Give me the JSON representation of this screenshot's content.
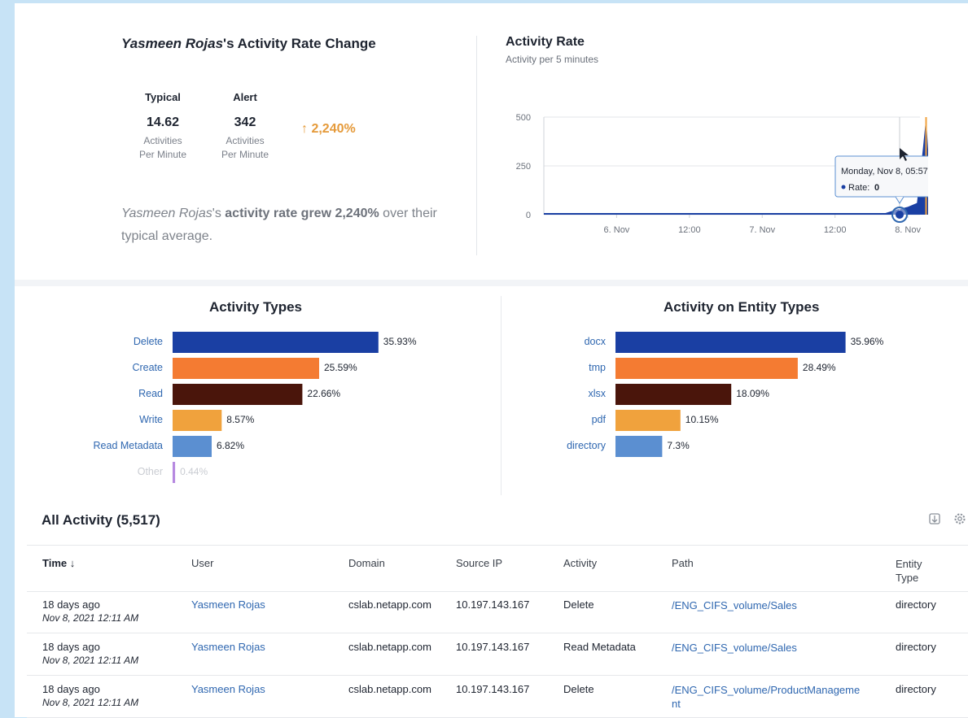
{
  "rate_change": {
    "user": "Yasmeen Rojas",
    "title_suffix": "'s Activity Rate Change",
    "typical_label": "Typical",
    "typical_value": "14.62",
    "typical_unit_1": "Activities",
    "typical_unit_2": "Per Minute",
    "alert_label": "Alert",
    "alert_value": "342",
    "alert_unit_1": "Activities",
    "alert_unit_2": "Per Minute",
    "change": "↑ 2,240%",
    "summary_suffix": "'s",
    "summary_bold": "activity rate grew 2,240%",
    "summary_rest": " over their typical average."
  },
  "activity_rate": {
    "title": "Activity Rate",
    "subtitle": "Activity per 5 minutes",
    "tooltip_date": "Monday, Nov 8, 05:57",
    "tooltip_label": "Rate:",
    "tooltip_value": "0"
  },
  "colors": {
    "navy": "#1a3fa3",
    "orange": "#f47b32",
    "brown": "#4a150b",
    "light_orange": "#f0a23d",
    "steel_blue": "#5b8fd1",
    "purple": "#a46ad8",
    "alert_orange": "#e59a3a",
    "link_blue": "#2f67b0"
  },
  "chart_data": [
    {
      "type": "line",
      "title": "Activity Rate",
      "subtitle": "Activity per 5 minutes",
      "x_tick_labels": [
        "6. Nov",
        "12:00",
        "7. Nov",
        "12:00",
        "8. Nov",
        "12:00"
      ],
      "y_tick_labels": [
        "0",
        "250",
        "500"
      ],
      "ylim": [
        0,
        550
      ],
      "series": [
        {
          "points": [
            [
              "Nov 5 12:00",
              2
            ],
            [
              "Nov 6 00:00",
              3
            ],
            [
              "Nov 6 12:00",
              2
            ],
            [
              "Nov 7 00:00",
              3
            ],
            [
              "Nov 7 12:00",
              2
            ],
            [
              "Nov 7 20:00",
              5
            ],
            [
              "Nov 7 22:00",
              25
            ],
            [
              "Nov 8 00:00",
              40
            ],
            [
              "Nov 8 01:30",
              60
            ],
            [
              "Nov 8 02:30",
              342
            ],
            [
              "Nov 8 03:00",
              500
            ],
            [
              "Nov 8 04:00",
              10
            ],
            [
              "Nov 8 05:57",
              0
            ],
            [
              "Nov 8 14:00",
              0
            ]
          ]
        }
      ]
    },
    {
      "type": "bar",
      "title": "Activity Types",
      "categories": [
        "Delete",
        "Create",
        "Read",
        "Write",
        "Read Metadata",
        "Other"
      ],
      "values": [
        35.93,
        25.59,
        22.66,
        8.57,
        6.82,
        0.44
      ],
      "labels": [
        "35.93%",
        "25.59%",
        "22.66%",
        "8.57%",
        "6.82%",
        "0.44%"
      ],
      "colors": [
        "#1a3fa3",
        "#f47b32",
        "#4a150b",
        "#f0a23d",
        "#5b8fd1",
        "#a46ad8"
      ]
    },
    {
      "type": "bar",
      "title": "Activity on Entity Types",
      "categories": [
        "docx",
        "tmp",
        "xlsx",
        "pdf",
        "directory"
      ],
      "values": [
        35.96,
        28.49,
        18.09,
        10.15,
        7.3
      ],
      "labels": [
        "35.96%",
        "28.49%",
        "18.09%",
        "10.15%",
        "7.3%"
      ],
      "colors": [
        "#1a3fa3",
        "#f47b32",
        "#4a150b",
        "#f0a23d",
        "#5b8fd1"
      ]
    }
  ],
  "table": {
    "title": "All Activity (5,517)",
    "headers": {
      "time": "Time ↓",
      "user": "User",
      "domain": "Domain",
      "source_ip": "Source IP",
      "activity": "Activity",
      "path": "Path",
      "entity_type_1": "Entity",
      "entity_type_2": "Type"
    },
    "rows": [
      {
        "time_rel": "18 days ago",
        "time_abs": "Nov 8, 2021 12:11 AM",
        "user": "Yasmeen Rojas",
        "domain": "cslab.netapp.com",
        "ip": "10.197.143.167",
        "activity": "Delete",
        "path_1": "/ENG_CIFS_volume/Sales",
        "path_2": "",
        "entity": "directory"
      },
      {
        "time_rel": "18 days ago",
        "time_abs": "Nov 8, 2021 12:11 AM",
        "user": "Yasmeen Rojas",
        "domain": "cslab.netapp.com",
        "ip": "10.197.143.167",
        "activity": "Read Metadata",
        "path_1": "/ENG_CIFS_volume/Sales",
        "path_2": "",
        "entity": "directory"
      },
      {
        "time_rel": "18 days ago",
        "time_abs": "Nov 8, 2021 12:11 AM",
        "user": "Yasmeen Rojas",
        "domain": "cslab.netapp.com",
        "ip": "10.197.143.167",
        "activity": "Delete",
        "path_1": "/ENG_CIFS_volume/ProductManageme",
        "path_2": "nt",
        "entity": "directory"
      }
    ]
  }
}
